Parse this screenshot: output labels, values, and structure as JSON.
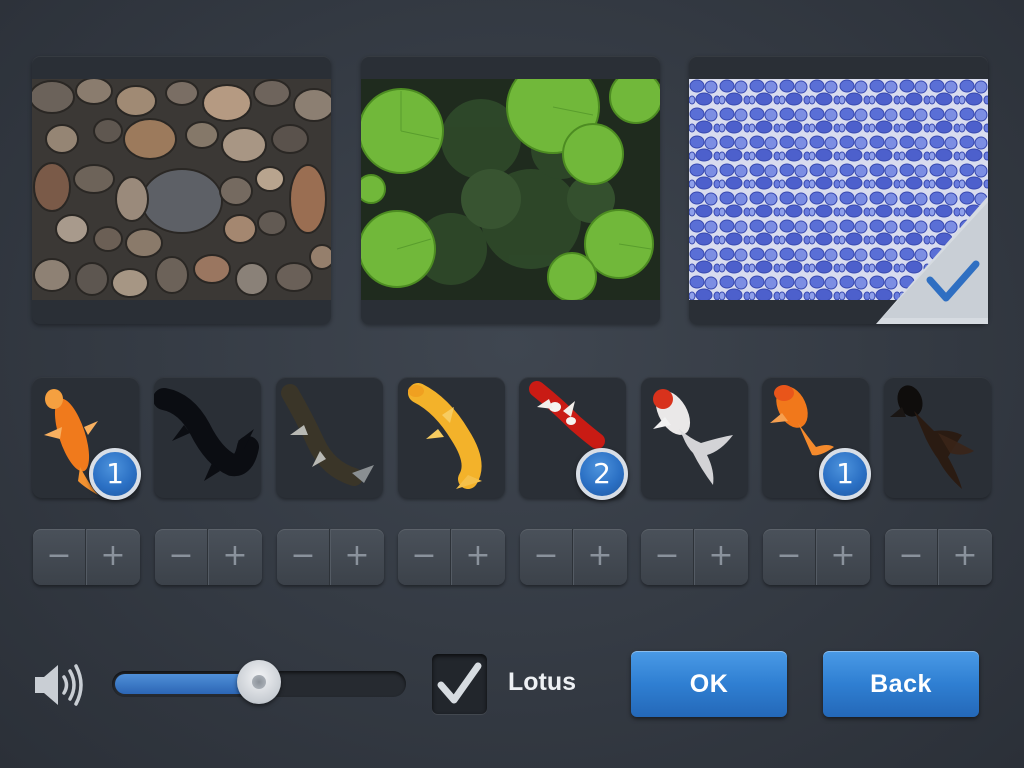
{
  "backgrounds": [
    {
      "name": "pebbles-background",
      "selected": false
    },
    {
      "name": "lotus-pond-background",
      "selected": false
    },
    {
      "name": "blue-mosaic-background",
      "selected": true
    }
  ],
  "fish": [
    {
      "icon": "orange-koi-icon",
      "count": "1"
    },
    {
      "icon": "black-koi-icon",
      "count": ""
    },
    {
      "icon": "dark-koi-icon",
      "count": ""
    },
    {
      "icon": "golden-koi-icon",
      "count": ""
    },
    {
      "icon": "red-white-koi-icon",
      "count": "2"
    },
    {
      "icon": "white-goldfish-icon",
      "count": ""
    },
    {
      "icon": "orange-goldfish-icon",
      "count": "1"
    },
    {
      "icon": "black-goldfish-icon",
      "count": ""
    }
  ],
  "stepper": {
    "minus": "−",
    "plus": "+"
  },
  "volume": {
    "icon": "speaker-icon",
    "level": 0.5
  },
  "lotus": {
    "label": "Lotus",
    "checked": true
  },
  "buttons": {
    "ok": "OK",
    "back": "Back"
  },
  "colors": {
    "accent": "#2f7fd2",
    "badge": "#2b70c4",
    "panel": "#2a2f36",
    "background": "#343a43"
  }
}
